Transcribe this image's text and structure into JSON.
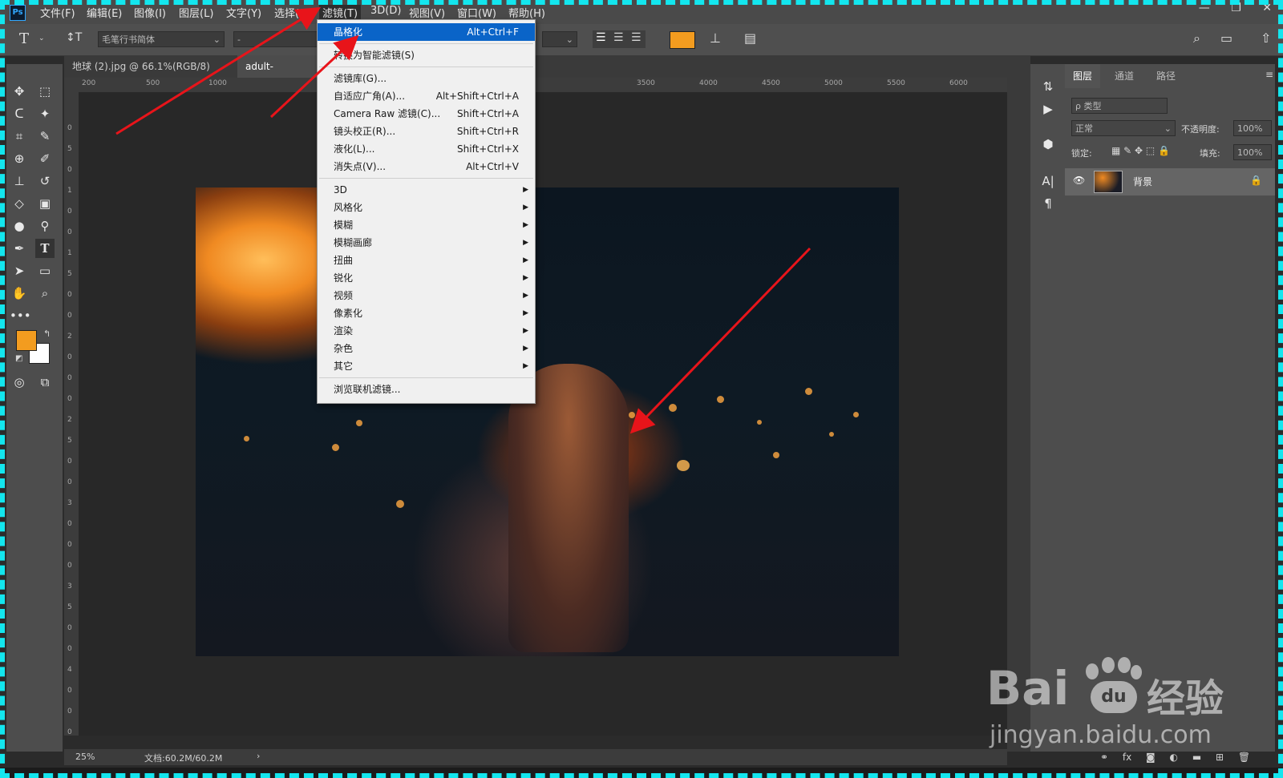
{
  "app": {
    "logo": "Ps"
  },
  "menubar": {
    "items": [
      "文件(F)",
      "编辑(E)",
      "图像(I)",
      "图层(L)",
      "文字(Y)",
      "选择(S)",
      "滤镜(T)",
      "3D(D)",
      "视图(V)",
      "窗口(W)",
      "帮助(H)"
    ],
    "active_index": 6
  },
  "options": {
    "font_family": "毛笔行书简体",
    "font_style": "-",
    "text_color": "#f39c1f"
  },
  "tabs": [
    {
      "label": "地球 (2).jpg @ 66.1%(RGB/8) *",
      "close": "×",
      "active": false
    },
    {
      "label": "adult-attractive",
      "close": "",
      "active": true
    }
  ],
  "rulers": {
    "h_ticks": [
      "200",
      "500",
      "1000",
      "3500",
      "4000",
      "4500",
      "5000",
      "5500",
      "6000"
    ],
    "v_ticks": [
      "0",
      "5",
      "0",
      "1",
      "0",
      "0",
      "1",
      "5",
      "0",
      "0",
      "2",
      "0",
      "0",
      "0",
      "2",
      "5",
      "0",
      "0",
      "3",
      "0",
      "0",
      "0",
      "3",
      "5",
      "0",
      "0",
      "4",
      "0",
      "0",
      "0"
    ]
  },
  "filter_menu": {
    "groups": [
      [
        {
          "label": "晶格化",
          "shortcut": "Alt+Ctrl+F",
          "highlighted": true
        }
      ],
      [
        {
          "label": "转换为智能滤镜(S)",
          "shortcut": ""
        }
      ],
      [
        {
          "label": "滤镜库(G)...",
          "shortcut": ""
        },
        {
          "label": "自适应广角(A)...",
          "shortcut": "Alt+Shift+Ctrl+A"
        },
        {
          "label": "Camera Raw 滤镜(C)...",
          "shortcut": "Shift+Ctrl+A"
        },
        {
          "label": "镜头校正(R)...",
          "shortcut": "Shift+Ctrl+R"
        },
        {
          "label": "液化(L)...",
          "shortcut": "Shift+Ctrl+X"
        },
        {
          "label": "消失点(V)...",
          "shortcut": "Alt+Ctrl+V"
        }
      ],
      [
        {
          "label": "3D",
          "submenu": true
        },
        {
          "label": "风格化",
          "submenu": true
        },
        {
          "label": "模糊",
          "submenu": true
        },
        {
          "label": "模糊画廊",
          "submenu": true
        },
        {
          "label": "扭曲",
          "submenu": true
        },
        {
          "label": "锐化",
          "submenu": true
        },
        {
          "label": "视频",
          "submenu": true
        },
        {
          "label": "像素化",
          "submenu": true
        },
        {
          "label": "渲染",
          "submenu": true
        },
        {
          "label": "杂色",
          "submenu": true
        },
        {
          "label": "其它",
          "submenu": true
        }
      ],
      [
        {
          "label": "浏览联机滤镜...",
          "shortcut": ""
        }
      ]
    ],
    "submenu_glyph": "▶"
  },
  "status": {
    "zoom": "25%",
    "doc": "文档:60.2M/60.2M",
    "arrow": "›"
  },
  "layers_panel": {
    "tabs": [
      "图层",
      "通道",
      "路径"
    ],
    "active_tab": 0,
    "filter_placeholder": "ρ 类型",
    "blend_mode": "正常",
    "opacity_label": "不透明度:",
    "opacity_value": "100%",
    "lock_label": "锁定:",
    "fill_label": "填充:",
    "fill_value": "100%",
    "layers": [
      {
        "name": "背景",
        "visible": true,
        "locked": true
      }
    ]
  },
  "colors": {
    "foreground": "#f39c1f",
    "background": "#ffffff",
    "arrow": "#e8141a",
    "frame": "#13e6ee",
    "menu_highlight": "#0a64c8"
  },
  "watermark": {
    "brand": "Bai",
    "paw": "du",
    "cn": "经验",
    "url": "jingyan.baidu.com"
  }
}
